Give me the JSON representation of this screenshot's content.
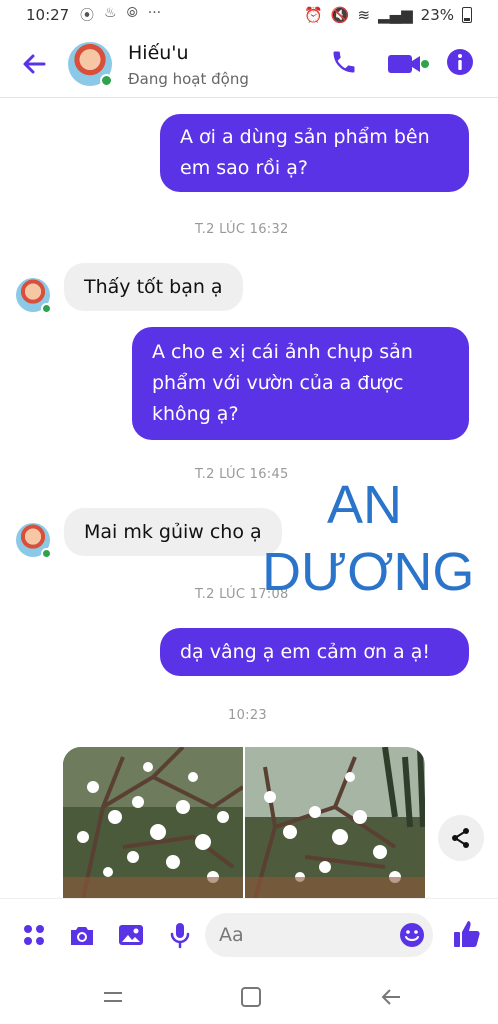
{
  "status_bar": {
    "time": "10:27",
    "battery": "23%"
  },
  "header": {
    "contact_name": "Hiếu'u",
    "contact_status": "Đang hoạt động"
  },
  "colors": {
    "accent": "#5b33e6",
    "online": "#31a24c",
    "watermark": "#2a74c9"
  },
  "messages": [
    {
      "type": "out",
      "text": "A ơi a dùng sản phẩm bên em sao rồi ạ?",
      "lines": [
        "A ơi a dùng sản phẩm bên",
        "em sao rồi ạ?"
      ]
    },
    {
      "type": "timestamp",
      "text": "T.2 LÚC 16:32"
    },
    {
      "type": "in",
      "text": "Thấy tốt bạn ạ"
    },
    {
      "type": "out",
      "lines": [
        "A cho e xị cái ảnh chụp sản",
        "phẩm với vườn của a được",
        "không ạ?"
      ]
    },
    {
      "type": "timestamp",
      "text": "T.2 LÚC 16:45"
    },
    {
      "type": "in",
      "text": "Mai mk gủiw cho ạ"
    },
    {
      "type": "timestamp",
      "text": "T.2 LÚC 17:08"
    },
    {
      "type": "out",
      "text": "dạ vâng ạ em cảm ơn a ạ!"
    },
    {
      "type": "timestamp",
      "text": "10:23"
    }
  ],
  "watermark": {
    "line1": "AN",
    "line2": "DƯƠNG"
  },
  "composer": {
    "placeholder": "Aa"
  },
  "icons": [
    "back-arrow-icon",
    "phone-icon",
    "video-camera-icon",
    "info-icon",
    "menu-dots-icon",
    "camera-icon",
    "image-icon",
    "microphone-icon",
    "emoji-icon",
    "thumbs-up-icon",
    "share-icon",
    "recent-apps-icon",
    "home-icon",
    "back-nav-icon"
  ]
}
